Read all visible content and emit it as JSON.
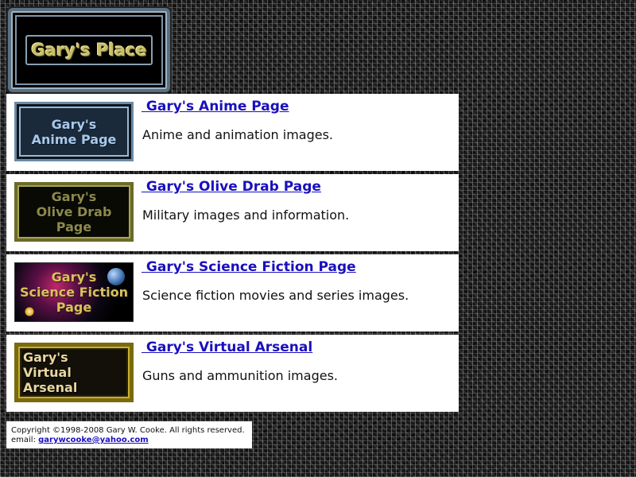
{
  "header": {
    "logo_text": "Gary's Place"
  },
  "links": [
    {
      "thumb_text": "Gary's\nAnime Page",
      "title": " Gary's Anime Page",
      "description": "Anime and animation images."
    },
    {
      "thumb_text": "Gary's\nOlive Drab\nPage",
      "title": " Gary's Olive Drab Page",
      "description": "Military images and information."
    },
    {
      "thumb_text": "Gary's\nScience Fiction\nPage",
      "title": " Gary's Science Fiction Page",
      "description": "Science fiction movies and series images."
    },
    {
      "thumb_text": "Gary's\nVirtual\nArsenal",
      "title": " Gary's Virtual Arsenal",
      "description": "Guns and ammunition images."
    }
  ],
  "footer": {
    "copyright": "Copyright ©1998-2008 Gary W. Cooke. All rights reserved.",
    "email_label": "email:",
    "email": "garywcooke@yahoo.com"
  },
  "colors": {
    "link": "#1a0fbe",
    "panel_background": "#ffffff"
  }
}
